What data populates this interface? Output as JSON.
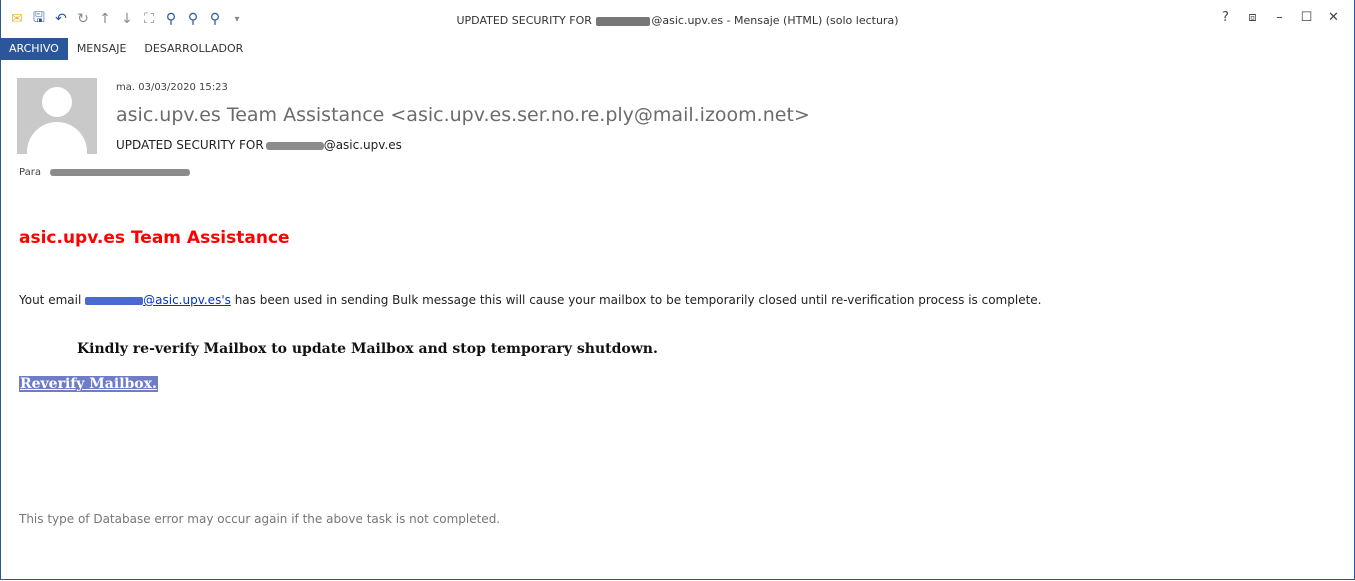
{
  "window": {
    "title_prefix": "UPDATED SECURITY FOR ",
    "title_suffix": "@asic.upv.es - Mensaje (HTML) (solo lectura)",
    "controls": [
      "?",
      "⧈",
      "–",
      "☐",
      "✕"
    ]
  },
  "quick_access": {
    "icons": [
      "mail-icon",
      "save-icon",
      "undo-icon",
      "redo-icon",
      "up-arrow-icon",
      "down-arrow-icon",
      "pin-icon",
      "zoom-icon",
      "print-preview-icon",
      "reply-icon",
      "customize-icon"
    ]
  },
  "tabs": [
    {
      "label": "ARCHIVO",
      "active": true
    },
    {
      "label": "MENSAJE",
      "active": false
    },
    {
      "label": "DESARROLLADOR",
      "active": false
    }
  ],
  "header": {
    "date": "ma. 03/03/2020 15:23",
    "sender": "asic.upv.es Team Assistance <asic.upv.es.ser.no.re.ply@mail.izoom.net>",
    "subject_prefix": "UPDATED SECURITY FOR",
    "subject_suffix": "@asic.upv.es",
    "to_label": "Para"
  },
  "message": {
    "heading": "asic.upv.es Team Assistance",
    "line_prefix": "Yout email ",
    "email_link_suffix": "@asic.upv.es's",
    "line_suffix": " has been used in sending Bulk message this will cause your mailbox to be temporarily closed until re-verification process is complete.",
    "kindly": "Kindly re-verify Mailbox to update Mailbox and stop temporary shutdown.",
    "reverify_link": "Reverify Mailbox.",
    "footer": "This type of Database error may occur again if the above task is not completed."
  },
  "colors": {
    "accent": "#2b579a",
    "heading_red": "#ff0000",
    "link_blue": "#0033cc",
    "highlight": "#6f7cc8"
  }
}
